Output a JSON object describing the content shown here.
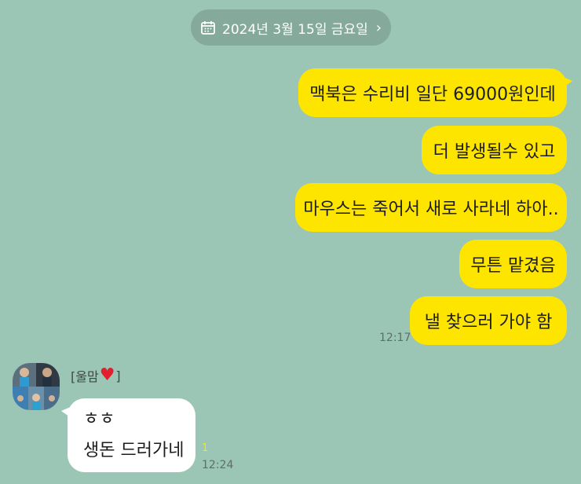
{
  "date_chip": {
    "text": "2024년 3월 15일 금요일",
    "chevron": "›"
  },
  "my_messages": [
    {
      "text": "맥북은 수리비 일단 69000원인데"
    },
    {
      "text": "더 발생될수 있고"
    },
    {
      "text": "마우스는 죽어서 새로 사라네 하아.."
    },
    {
      "text": "무튼 맡겼음"
    },
    {
      "text": "낼 찾으러 가야 함"
    }
  ],
  "my_time": "12:17",
  "incoming": {
    "sender_prefix": "[울맘",
    "sender_heart": "♥",
    "sender_suffix": "]",
    "lines": [
      "ㅎㅎ",
      "생돈 드러가네"
    ],
    "unread_count": "1",
    "time": "12:24"
  },
  "colors": {
    "background": "#9bc6b5",
    "my_bubble": "#fde500",
    "their_bubble": "#ffffff",
    "date_chip": "#85aa9b"
  },
  "icons": {
    "date_chip": "calendar-icon",
    "date_chip_chevron": "chevron-right-icon",
    "sender_heart": "heart-icon"
  }
}
